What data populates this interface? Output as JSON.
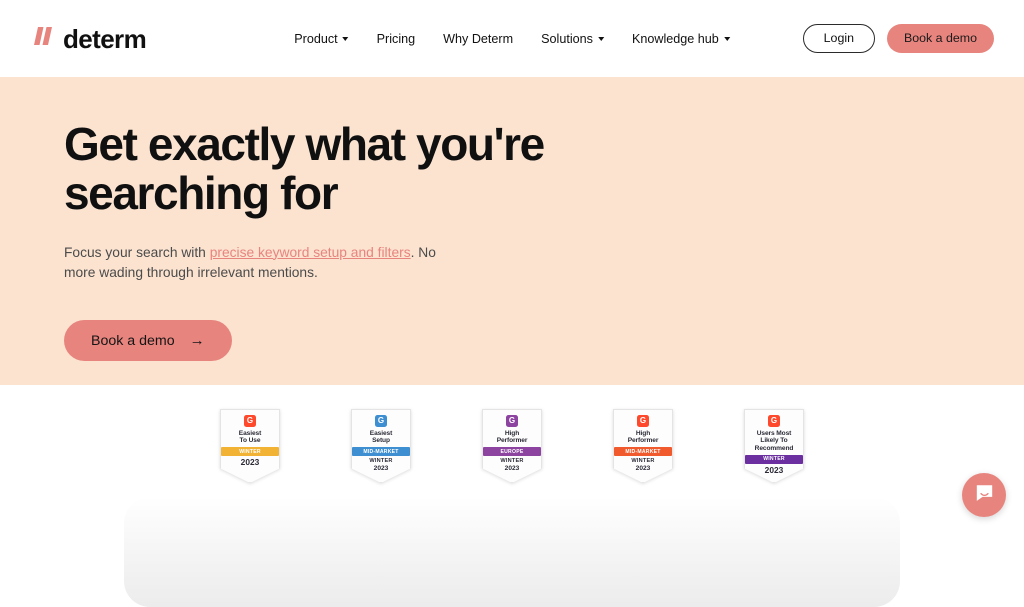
{
  "header": {
    "logo_text": "determ",
    "logo_icon": "determ-slash-logo",
    "nav": [
      {
        "label": "Product",
        "has_caret": true
      },
      {
        "label": "Pricing",
        "has_caret": false
      },
      {
        "label": "Why Determ",
        "has_caret": false
      },
      {
        "label": "Solutions",
        "has_caret": true
      },
      {
        "label": "Knowledge hub",
        "has_caret": true
      }
    ],
    "login_label": "Login",
    "demo_label": "Book a demo"
  },
  "hero": {
    "title": "Get exactly what you're searching for",
    "sub_before": "Focus your search with ",
    "sub_link": "precise keyword setup and filters",
    "sub_after": ". No more wading through irrelevant mentions.",
    "cta_label": "Book a demo",
    "cta_arrow": "→",
    "background": "#fbe3d0"
  },
  "badges": [
    {
      "title": "Easiest\nTo Use",
      "band_text": "Winter",
      "band_color": "#f2b335",
      "logo_color": "#ff492c",
      "footer_year": "2023",
      "footer_winter": "",
      "name": "g2-badge-easiest-to-use"
    },
    {
      "title": "Easiest\nSetup",
      "band_text": "Mid-Market",
      "band_color": "#3d8fd1",
      "logo_color": "#3d8fd1",
      "footer_year": "2023",
      "footer_winter": "Winter",
      "name": "g2-badge-easiest-setup"
    },
    {
      "title": "High\nPerformer",
      "band_text": "Europe",
      "band_color": "#8c44a0",
      "logo_color": "#8c44a0",
      "footer_year": "2023",
      "footer_winter": "Winter",
      "name": "g2-badge-high-performer-europe"
    },
    {
      "title": "High\nPerformer",
      "band_text": "Mid-Market",
      "band_color": "#f05a2d",
      "logo_color": "#ff492c",
      "footer_year": "2023",
      "footer_winter": "Winter",
      "name": "g2-badge-high-performer-mid-market"
    },
    {
      "title": "Users Most\nLikely To\nRecommend",
      "band_text": "Winter",
      "band_color": "#6b2fa0",
      "logo_color": "#ff492c",
      "footer_year": "2023",
      "footer_winter": "",
      "name": "g2-badge-users-most-likely-to-recommend"
    }
  ],
  "chat": {
    "icon": "chat-message-icon",
    "color": "#e8847e"
  },
  "colors": {
    "accent": "#e8847e",
    "hero_bg": "#fbe3d0",
    "text": "#111111"
  }
}
